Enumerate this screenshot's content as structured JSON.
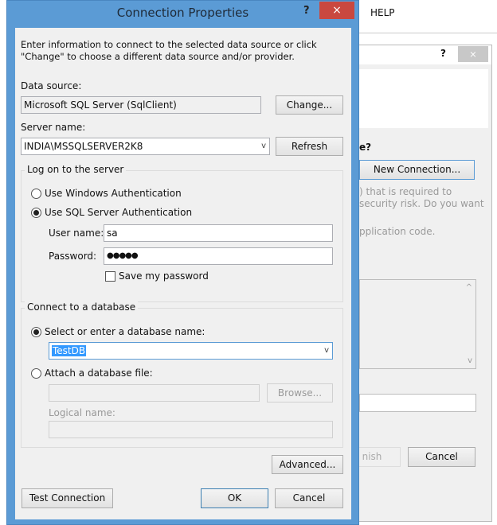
{
  "background": {
    "menu_help": "HELP",
    "dialog": {
      "help": "?",
      "close": "×",
      "question_fragment": "e?",
      "new_connection": "New Connection...",
      "text_line1": ") that is required to",
      "text_line2": "security risk. Do you want",
      "text_line3": "pplication code.",
      "finish": "nish",
      "cancel": "Cancel"
    }
  },
  "dialog": {
    "title": "Connection Properties",
    "help": "?",
    "close": "×",
    "intro": "Enter information to connect to the selected data source or click \"Change\" to choose a different data source and/or provider.",
    "data_source_label": "Data source:",
    "data_source_value": "Microsoft SQL Server (SqlClient)",
    "change_button": "Change...",
    "server_name_label": "Server name:",
    "server_name_value": "INDIA\\MSSQLSERVER2K8",
    "refresh_button": "Refresh",
    "logon_group": "Log on to the server",
    "windows_auth": "Use Windows Authentication",
    "sql_auth": "Use SQL Server Authentication",
    "user_name_label": "User name:",
    "user_name_value": "sa",
    "password_label": "Password:",
    "password_value": "●●●●●",
    "save_password": "Save my password",
    "db_group": "Connect to a database",
    "select_db": "Select or enter a database name:",
    "db_value": "TestDB",
    "attach_db": "Attach a database file:",
    "browse_button": "Browse...",
    "logical_name_label": "Logical name:",
    "advanced_button": "Advanced...",
    "test_button": "Test Connection",
    "ok_button": "OK",
    "cancel_button": "Cancel"
  }
}
